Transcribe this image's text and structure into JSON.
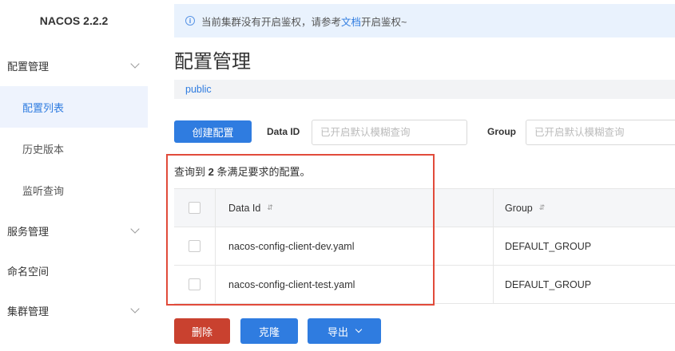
{
  "sidebar": {
    "brand": "NACOS 2.2.2",
    "items": [
      {
        "label": "配置管理",
        "expandable": true
      },
      {
        "label": "配置列表",
        "active": true
      },
      {
        "label": "历史版本"
      },
      {
        "label": "监听查询"
      },
      {
        "label": "服务管理",
        "expandable": true
      },
      {
        "label": "命名空间"
      },
      {
        "label": "集群管理",
        "expandable": true
      }
    ]
  },
  "notice": {
    "icon": "info-icon",
    "text_before": "当前集群没有开启鉴权，请参考",
    "link": "文档",
    "text_after": "开启鉴权~"
  },
  "page": {
    "title": "配置管理",
    "namespace": "public"
  },
  "toolbar": {
    "create_label": "创建配置",
    "data_id_label": "Data ID",
    "data_id_placeholder": "已开启默认模糊查询",
    "group_label": "Group",
    "group_placeholder": "已开启默认模糊查询"
  },
  "result": {
    "prefix": "查询到",
    "count": "2",
    "suffix": "条满足要求的配置。"
  },
  "table": {
    "columns": [
      "Data Id",
      "Group"
    ],
    "rows": [
      {
        "data_id": "nacos-config-client-dev.yaml",
        "group": "DEFAULT_GROUP"
      },
      {
        "data_id": "nacos-config-client-test.yaml",
        "group": "DEFAULT_GROUP"
      }
    ]
  },
  "actions": {
    "delete_label": "删除",
    "clone_label": "克隆",
    "export_label": "导出"
  },
  "colors": {
    "primary": "#2f7ce0",
    "danger": "#c9412f",
    "highlight": "#e14b3b"
  }
}
